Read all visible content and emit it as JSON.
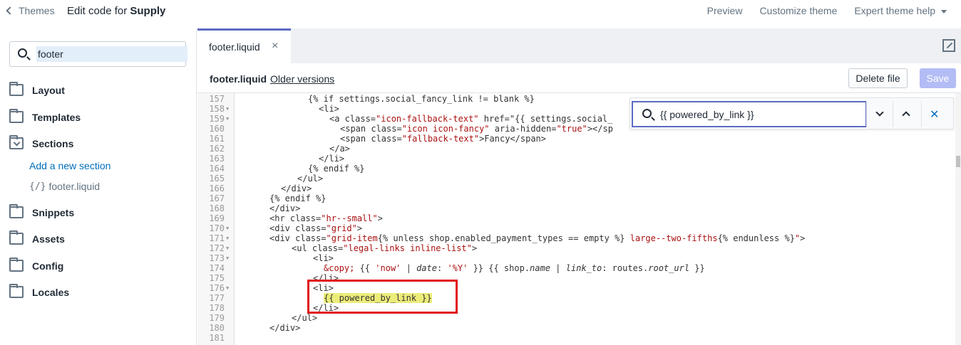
{
  "topbar": {
    "back_label": "Themes",
    "title_prefix": "Edit code for ",
    "title_theme": "Supply",
    "links": [
      "Preview",
      "Customize theme",
      "Expert theme help"
    ]
  },
  "sidebar": {
    "search_value": "footer",
    "folders": [
      {
        "label": "Layout"
      },
      {
        "label": "Templates"
      },
      {
        "label": "Sections"
      },
      {
        "label": "Snippets"
      },
      {
        "label": "Assets"
      },
      {
        "label": "Config"
      },
      {
        "label": "Locales"
      }
    ],
    "add_section_label": "Add a new section",
    "file_brace": "{/}",
    "file_label": "footer.liquid"
  },
  "editor": {
    "tab_label": "footer.liquid",
    "tab_close": "×",
    "file_name": "footer.liquid",
    "older_versions": "Older versions",
    "delete_label": "Delete file",
    "save_label": "Save"
  },
  "find": {
    "value": "{{ powered_by_link }}",
    "close": "✕"
  },
  "code_lines": [
    {
      "n": "157",
      "fold": false
    },
    {
      "n": "158",
      "fold": true
    },
    {
      "n": "159",
      "fold": true
    },
    {
      "n": "160",
      "fold": false
    },
    {
      "n": "161",
      "fold": false
    },
    {
      "n": "162",
      "fold": false
    },
    {
      "n": "163",
      "fold": false
    },
    {
      "n": "164",
      "fold": false
    },
    {
      "n": "165",
      "fold": false
    },
    {
      "n": "166",
      "fold": false
    },
    {
      "n": "167",
      "fold": false
    },
    {
      "n": "168",
      "fold": false
    },
    {
      "n": "169",
      "fold": false
    },
    {
      "n": "170",
      "fold": true
    },
    {
      "n": "171",
      "fold": true
    },
    {
      "n": "172",
      "fold": true
    },
    {
      "n": "173",
      "fold": true
    },
    {
      "n": "174",
      "fold": false
    },
    {
      "n": "175",
      "fold": false
    },
    {
      "n": "176",
      "fold": true
    },
    {
      "n": "177",
      "fold": false
    },
    {
      "n": "178",
      "fold": false
    },
    {
      "n": "179",
      "fold": false
    },
    {
      "n": "180",
      "fold": false
    },
    {
      "n": "181",
      "fold": false
    }
  ],
  "code_text": {
    "l157": "{% if settings.social_fancy_link != blank %}",
    "l158": "<li>",
    "l159a": "<a class=",
    "l159b": "\"icon-fallback-text\"",
    "l159c": " href=\"{{ settings.social_",
    "l160a": "<span class=",
    "l160b": "\"icon icon-fancy\"",
    "l160c": " aria-hidden=",
    "l160d": "\"true\"",
    "l160e": "></sp",
    "l161a": "<span class=",
    "l161b": "\"fallback-text\"",
    "l161c": ">Fancy</span>",
    "l162": "</a>",
    "l163": "</li>",
    "l164": "{% endif %}",
    "l165": "</ul>",
    "l166": "</div>",
    "l167": "{% endif %}",
    "l168": "</div>",
    "l169a": "<hr class=",
    "l169b": "\"hr--small\"",
    "l169c": ">",
    "l170a": "<div class=",
    "l170b": "\"grid\"",
    "l170c": ">",
    "l171a": "<div class=",
    "l171b": "\"grid-item",
    "l171c": "{% unless shop.enabled_payment_types == empty %}",
    "l171d": " large--two-fifths",
    "l171e": "{% endunless %}",
    "l171f": "\"",
    "l171g": ">",
    "l172a": "<ul class=",
    "l172b": "\"legal-links inline-list\"",
    "l172c": ">",
    "l173": "<li>",
    "l174a": "&copy;",
    "l174b": " {{ ",
    "l174c": "'now'",
    "l174d": " | ",
    "l174e": "date",
    "l174f": ": ",
    "l174g": "'%Y'",
    "l174h": " }} {{ shop.",
    "l174i": "name",
    "l174j": " | ",
    "l174k": "link_to",
    "l174l": ": routes.",
    "l174m": "root_url",
    "l174n": " }}",
    "l175": "</li>",
    "l176": "<li>",
    "l177": "{{ powered_by_link }}",
    "l178": "</li>",
    "l179": "</ul>",
    "l180": "</div>",
    "l181": ""
  }
}
